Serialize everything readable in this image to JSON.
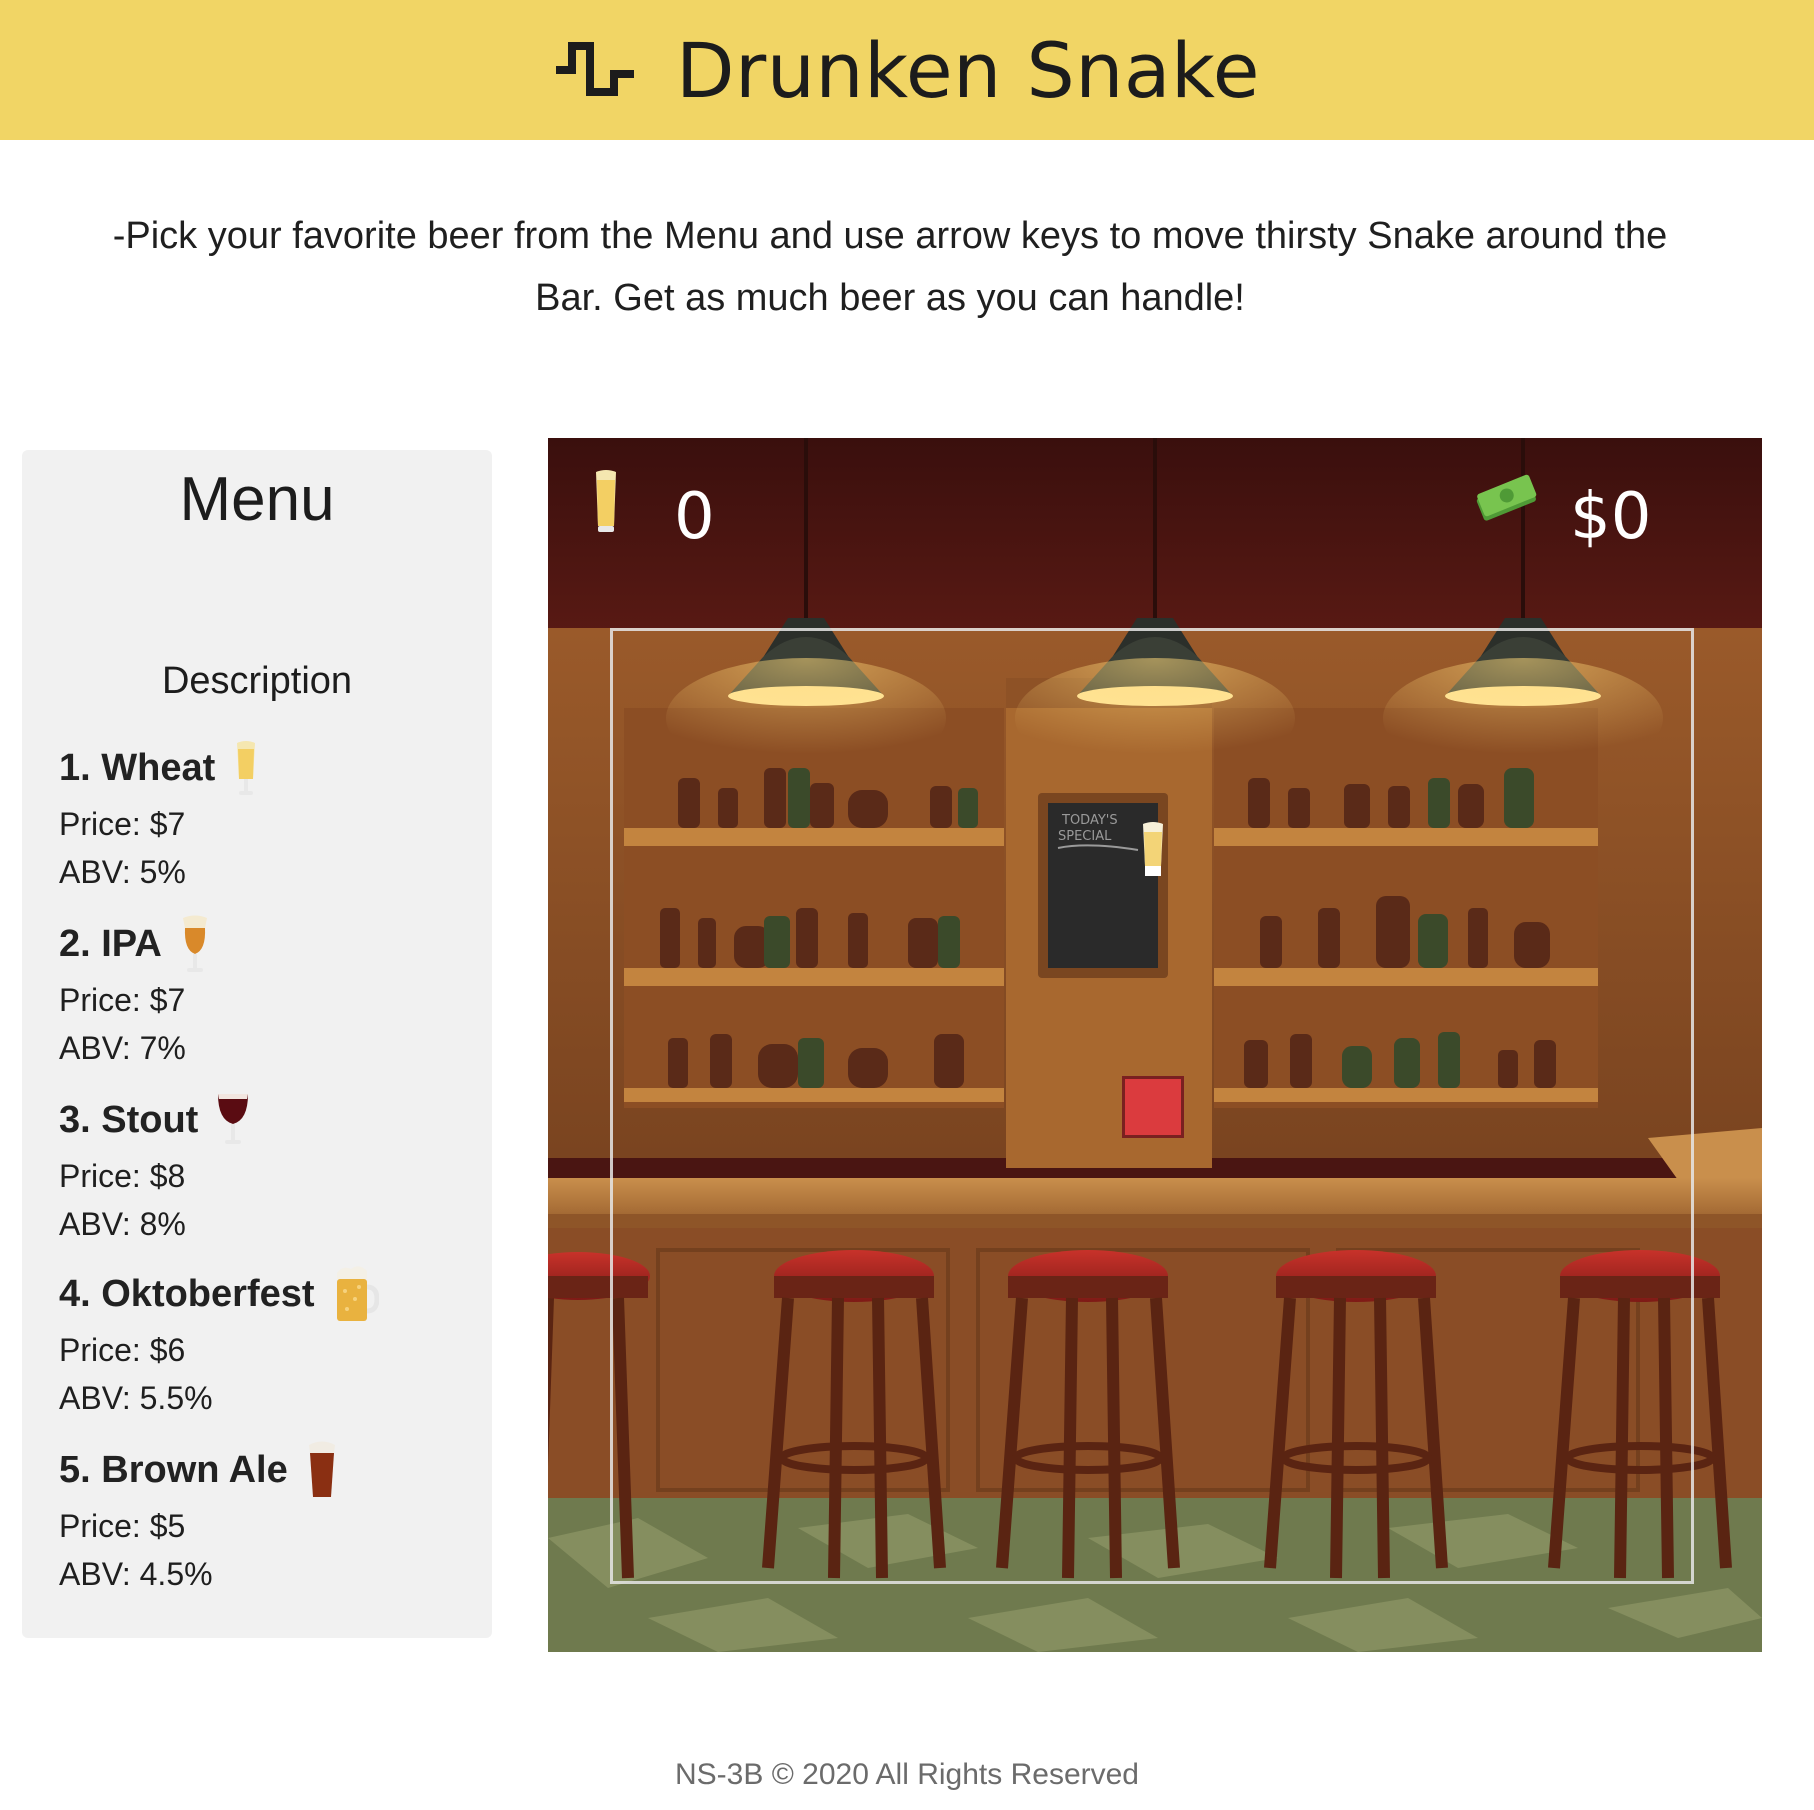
{
  "header": {
    "title": "Drunken Snake",
    "logo_icon": "snake-wave-icon"
  },
  "intro": "-Pick your favorite beer from the Menu and use arrow keys to move thirsty Snake around the Bar. Get as much beer as you can handle!",
  "menu": {
    "title": "Menu",
    "description_title": "Description",
    "beers": [
      {
        "name": "1. Wheat",
        "price": "Price: $7",
        "abv": "ABV: 5%",
        "icon": "wheat-beer-glass-icon",
        "color": "#f5d77a"
      },
      {
        "name": "2. IPA",
        "price": "Price: $7",
        "abv": "ABV: 7%",
        "icon": "ipa-glass-icon",
        "color": "#d9892a"
      },
      {
        "name": "3. Stout",
        "price": "Price: $8",
        "abv": "ABV: 8%",
        "icon": "stout-glass-icon",
        "color": "#5a0c12"
      },
      {
        "name": "4. Oktoberfest",
        "price": "Price: $6",
        "abv": "ABV: 5.5%",
        "icon": "beer-mug-icon",
        "color": "#e9b23f"
      },
      {
        "name": "5. Brown Ale",
        "price": "Price: $5",
        "abv": "ABV: 4.5%",
        "icon": "brown-ale-glass-icon",
        "color": "#8a2f12"
      }
    ]
  },
  "game": {
    "beer_count": "0",
    "money": "$0",
    "beer_counter_icon": "beer-glass-icon",
    "money_icon": "money-stack-icon",
    "chalkboard_text": "TODAY'S SPECIAL",
    "snake_color": "#db3b3e"
  },
  "footer": "NS-3B © 2020 All Rights Reserved"
}
